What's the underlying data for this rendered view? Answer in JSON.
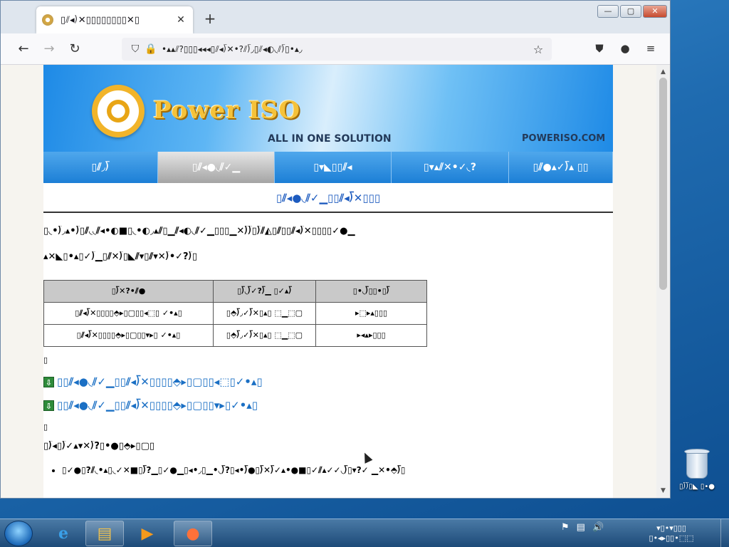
{
  "browser": {
    "tab_title": "▯⫽◂⟌✕▯▯▯▯▯▯▯▯✕▯",
    "tab_close": "✕",
    "new_tab": "+",
    "url": "•▴▴⫽?▯▯▯◂◂◂▯⫽◂⟌✕•?⫽⟌◞▯⫽◂◐◟⫽⟌▯•▴◞",
    "win_minimize": "—",
    "win_maximize": "▢",
    "win_close": "✕",
    "back_icon": "←",
    "forward_icon": "→",
    "reload_icon": "↻",
    "shield_icon": "⛉",
    "lock_icon": "🔒",
    "star_icon": "☆",
    "pocket_icon": "⛊",
    "account_icon": "●",
    "menu_icon": "≡"
  },
  "page": {
    "logo_text": "Power ISO",
    "tagline": "ALL IN ONE SOLUTION",
    "site": "POWERISO.COM",
    "menu": [
      {
        "label": "▯⫽◞⟌"
      },
      {
        "label": "▯⫽◂●◟⫽✓▁"
      },
      {
        "label": "▯▾◣▯▯⫽◂"
      },
      {
        "label": "▯▾▴⫽✕•✓◟?"
      },
      {
        "label": "▯⫽●▴✓⟌▴ ▯▯"
      }
    ],
    "heading": "▯⫽◂●◟⫽✓▁▯▯⫽◂⟌✕▯▯▯",
    "para1": "▯◟•⟌◞▴•⟌▯⫽◟◟⫽◂•◐■▯◟•◐◞▴⫽▯▁⫽◂◐◟⫽✓▁▯▯▯▁✕⟌⟌▯⟌⫽◭▯⫽▯▯⫽◂⟌✕▯▯▯▯✓●▁",
    "para2": "▴✕◣▯•▴▯✓⟌▁▯⫽✕⟌▯◣⫽▾▯⫽▾✕⟌•✓?⟌▯",
    "table": {
      "headers": [
        "▯⟌✕?•⫽●",
        "▯⟌◟⟌✓?⟌▁ ▯✓▴⟌",
        "▯•◟⟌▯▯•▯⟌"
      ],
      "rows": [
        [
          "▯⫽◂⟌✕▯▯▯▯⬘▸▯▢▯▯◂⬚▯ ✓•▴▯",
          "▯⬘⟌◞✓⟌✕▯▴▯ ⬚▁⬚▢",
          "▸⬚▸▴▯▯▯"
        ],
        [
          "▯⫽◂⟌✕▯▯▯▯⬘▸▯▢▯▯▾▸▯ ✓•▴▯",
          "▯⬘⟌◞✓⟌✕▯▴▯ ⬚▁⬚▢",
          "▸◂▴▸▯▯▯"
        ]
      ]
    },
    "marker1": "▯",
    "link1": "▯▯⫽◂●◟⫽✓▁▯▯⫽◂⟌✕▯▯▯▯⬘▸▯▢▯▯◂⬚▯✓•▴▯",
    "link2": "▯▯⫽◂●◟⫽✓▁▯▯⫽◂⟌✕▯▯▯▯⬘▸▯▢▯▯▾▸▯✓•▴▯",
    "link_icon": "⇩",
    "marker2": "▯",
    "para3": "▯⟌◂▯⟌✓▴▾✕⟌?▯•●▯⬘▸▯▢▯",
    "notes": [
      "▯✓●▯?⫽◟•▴▯◟✓✕■▯⟌?▁▯✓●▁▯◂•◞▯▁•◟⟌?▯◂•⟌●▯⟌✕⟌✓▴•●■▯✓⫽▴✓✓◟⟌▯▾?✓ ▁✕•⬘⟌▯"
    ]
  },
  "desktop": {
    "recycle_bin_label": "▯⟌⟌▯◣ ▯•●"
  },
  "taskbar": {
    "tray_icons": [
      "⚑",
      "▤",
      "🔊"
    ],
    "clock_time": "▾▯•▾▯▯▯",
    "clock_date": "▯•◂▸▯▯•⬚⬚"
  }
}
